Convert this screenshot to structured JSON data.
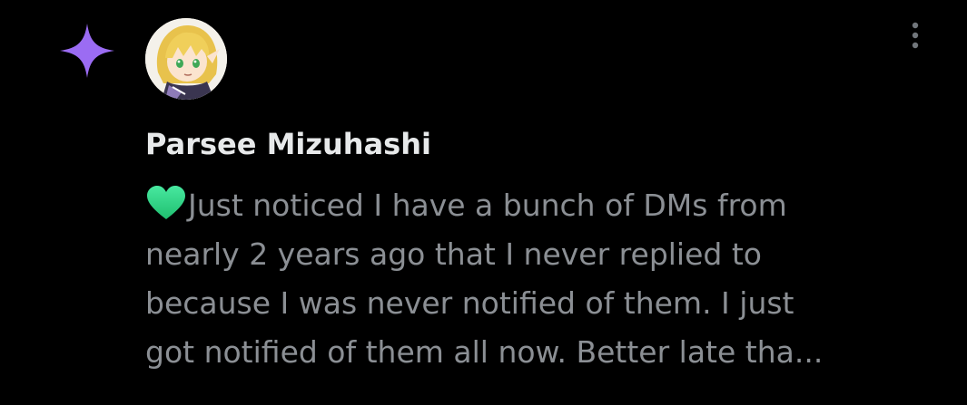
{
  "post": {
    "author_name": "Parsee Mizuhashi",
    "heart_emoji": "💚",
    "text_lines": [
      "Just noticed I have a bunch of DMs from",
      "nearly 2 years ago that I never replied to",
      "because I was never notified of them. I just",
      "got notified of them all now. Better late tha..."
    ]
  },
  "icons": {
    "sparkle": "sparkle-icon",
    "more": "more-vertical-icon",
    "heart": "green-heart-icon"
  },
  "colors": {
    "background": "#000000",
    "author": "#e7e9ea",
    "body_text": "#8b8f94",
    "sparkle": "#9b6cf3",
    "heart": "#2fd98a"
  }
}
